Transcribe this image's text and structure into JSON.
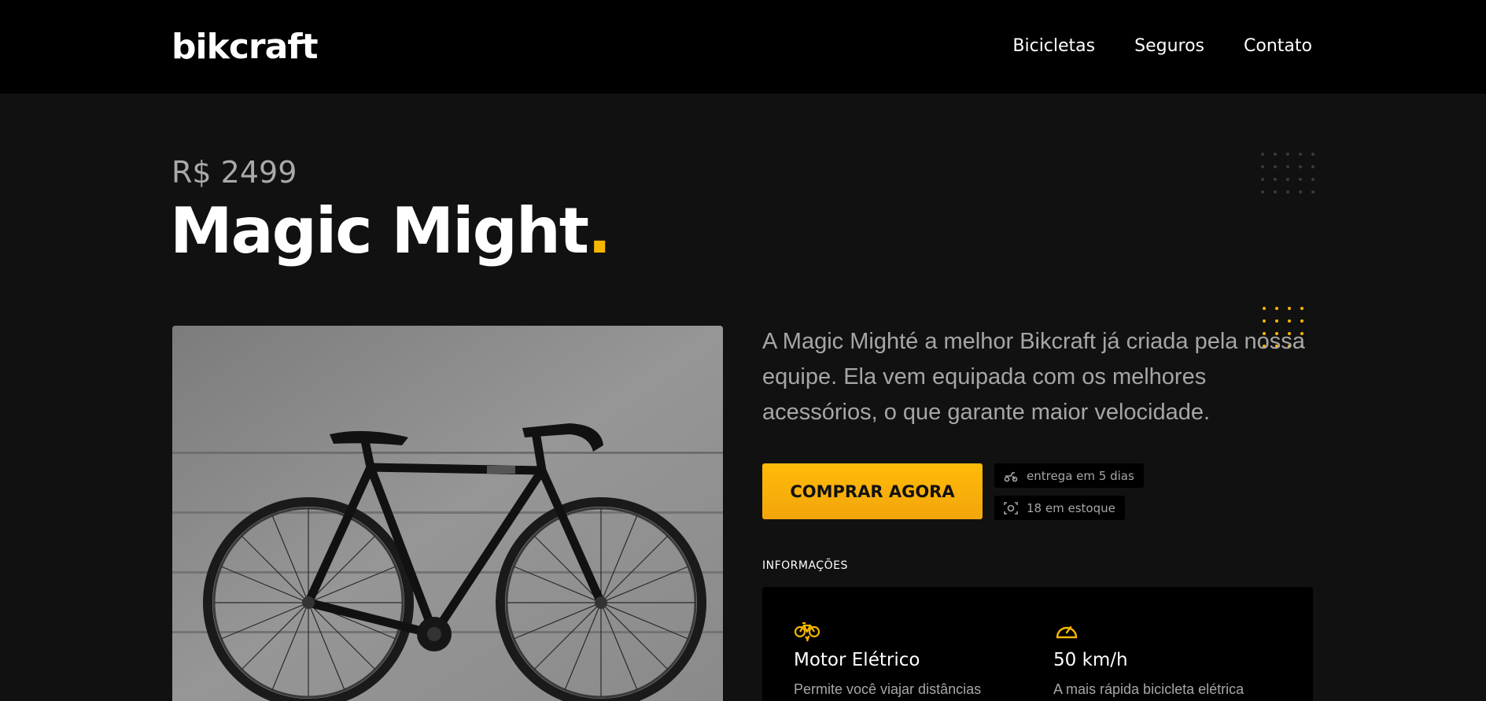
{
  "header": {
    "logo": "bikcraft",
    "nav": [
      "Bicicletas",
      "Seguros",
      "Contato"
    ]
  },
  "product": {
    "price": "R$ 2499",
    "title": "Magic Might",
    "title_dot": ".",
    "description": "A Magic Mighté a melhor Bikcraft já criada pela nossa equipe. Ela vem equipada com os melhores acessórios, o que garante maior velocidade.",
    "buy_label": "COMPRAR AGORA",
    "delivery": "entrega em 5 dias",
    "stock": "18 em estoque"
  },
  "info": {
    "label": "INFORMAÇÕES",
    "features": [
      {
        "icon": "electric-bike-icon",
        "title": "Motor Elétrico",
        "text": "Permite você viajar distâncias"
      },
      {
        "icon": "speedometer-icon",
        "title": "50 km/h",
        "text": "A mais rápida bicicleta elétrica"
      }
    ]
  },
  "colors": {
    "accent": "#f8b603",
    "background": "#111111",
    "header": "#000000"
  }
}
